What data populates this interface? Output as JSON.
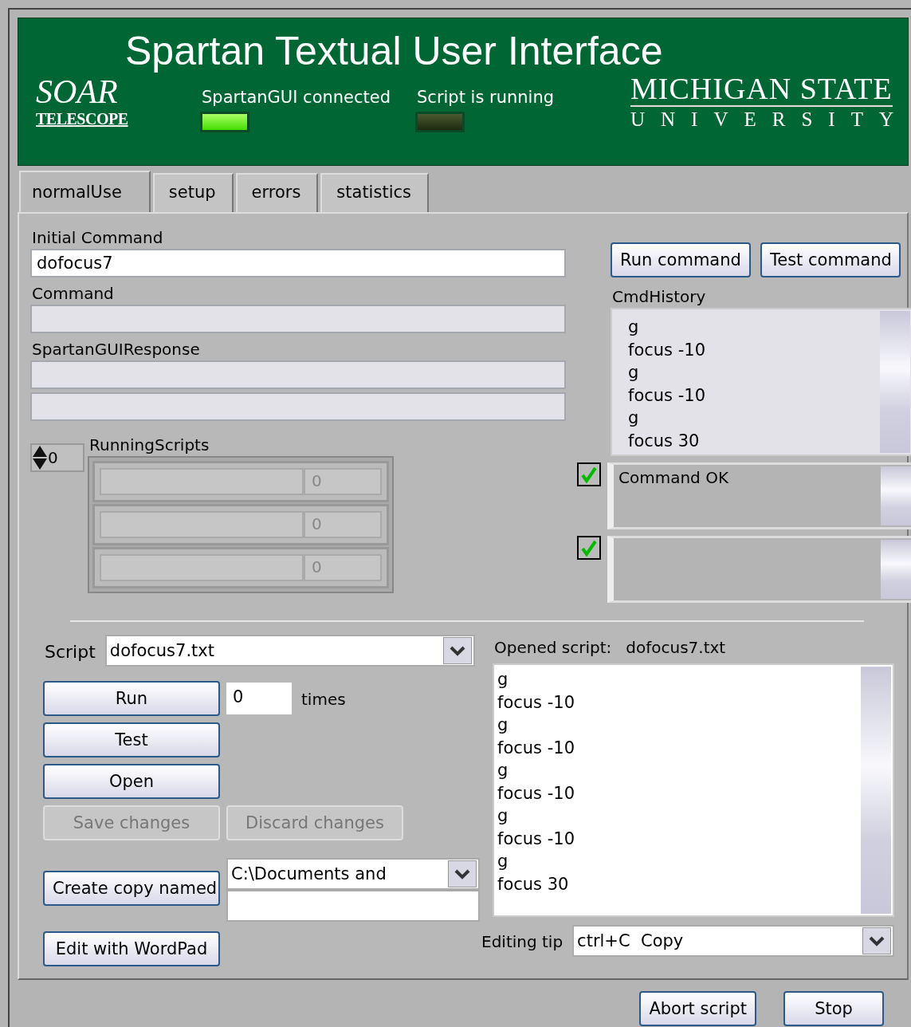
{
  "header": {
    "title": "Spartan Textual User Interface",
    "logo_left": {
      "name": "SOAR",
      "sub": "TELESCOPE"
    },
    "logo_right": {
      "line1": "MICHIGAN STATE",
      "line2": "UNIVERSITY"
    },
    "indicators": [
      {
        "label": "SpartanGUI connected",
        "on": true
      },
      {
        "label": "Script is running",
        "on": false
      }
    ]
  },
  "tabs": [
    {
      "label": "normalUse",
      "selected": true
    },
    {
      "label": "setup",
      "selected": false
    },
    {
      "label": "errors",
      "selected": false
    },
    {
      "label": "statistics",
      "selected": false
    }
  ],
  "initial_command": {
    "label": "Initial Command",
    "value": "dofocus7"
  },
  "command_buttons": [
    {
      "label": "Run command"
    },
    {
      "label": "Test command"
    }
  ],
  "command": {
    "label": "Command"
  },
  "response": {
    "label": "SpartanGUIResponse"
  },
  "cmd_history": {
    "label": "CmdHistory",
    "items": [
      "g",
      "focus -10",
      "g",
      "focus -10",
      "g",
      "focus 30"
    ]
  },
  "running_scripts": {
    "label": "RunningScripts",
    "counter": "0",
    "rows": [
      {
        "count": "0"
      },
      {
        "count": "0"
      },
      {
        "count": "0"
      }
    ]
  },
  "status": [
    {
      "checked": true,
      "text": "Command OK"
    },
    {
      "checked": true
    }
  ],
  "script": {
    "label": "Script",
    "value": "dofocus7.txt"
  },
  "script_buttons": [
    {
      "label": "Run",
      "disabled": false
    },
    {
      "label": "Test",
      "disabled": false
    },
    {
      "label": "Open",
      "disabled": false
    },
    {
      "label": "Save changes",
      "disabled": true
    },
    {
      "label": "Discard changes",
      "disabled": true
    }
  ],
  "repeat": {
    "value": "0",
    "unit": "times"
  },
  "copy": {
    "button": "Create copy named",
    "path": "C:\\Documents and"
  },
  "wordpad_button": "Edit with WordPad",
  "opened_script": {
    "label": "Opened script:",
    "name": "dofocus7.txt",
    "lines": [
      "g",
      "focus -10",
      "g",
      "focus -10",
      "g",
      "focus -10",
      "g",
      "focus -10",
      "g",
      "focus 30"
    ]
  },
  "editing_tip": {
    "label": "Editing tip",
    "value": "ctrl+C  Copy"
  },
  "footer_buttons": [
    {
      "label": "Abort script"
    },
    {
      "label": "Stop"
    }
  ]
}
